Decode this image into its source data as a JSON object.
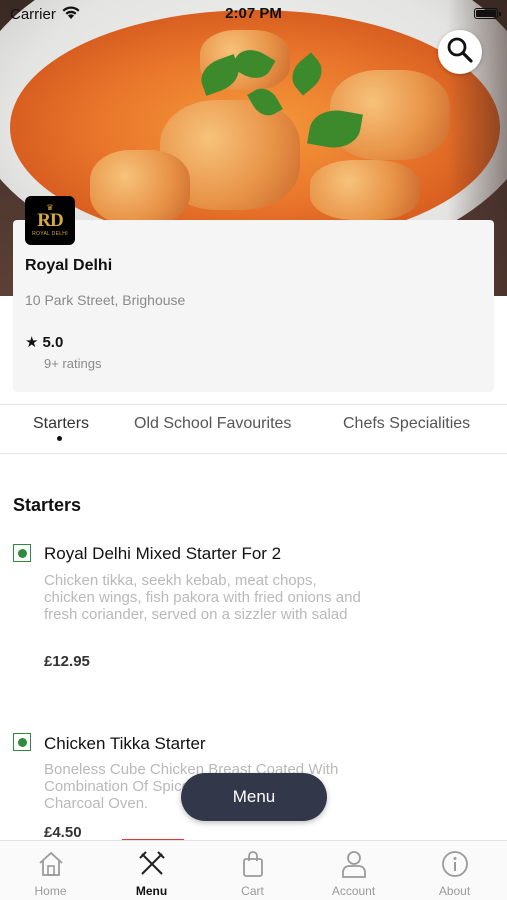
{
  "status_bar": {
    "carrier": "Carrier",
    "time": "2:07 PM"
  },
  "restaurant": {
    "logo_text": "RD",
    "logo_subtext": "ROYAL DELHI",
    "name": "Royal Delhi",
    "address": "10 Park Street, Brighouse",
    "rating": "5.0",
    "ratings_count": "9+ ratings"
  },
  "category_tabs": [
    {
      "label": "Starters",
      "active": true
    },
    {
      "label": "Old School Favourites",
      "active": false
    },
    {
      "label": "Chefs Specialities",
      "active": false
    }
  ],
  "section": {
    "title": "Starters",
    "items": [
      {
        "name": "Royal Delhi Mixed Starter For 2",
        "description": "Chicken tikka, seekh kebab, meat chops, chicken wings, fish pakora with fried onions and fresh coriander, served on a sizzler with salad",
        "price": "£12.95"
      },
      {
        "name": "Chicken Tikka Starter",
        "description": "Boneless Cube Chicken Breast Coated With Combination Of Spices And Cooked In Charcoal Oven.",
        "price": "£4.50"
      }
    ]
  },
  "floating_button": {
    "label": "Menu"
  },
  "bottom_nav": [
    {
      "label": "Home",
      "icon": "home-icon"
    },
    {
      "label": "Menu",
      "icon": "fork-knife-icon",
      "active": true
    },
    {
      "label": "Cart",
      "icon": "shopping-bag-icon"
    },
    {
      "label": "Account",
      "icon": "user-icon"
    },
    {
      "label": "About",
      "icon": "info-icon"
    }
  ],
  "colors": {
    "accent_red": "#d83a3a",
    "veg_green": "#2e8b3e",
    "dark_button": "#323849",
    "logo_gold": "#d8a93c"
  }
}
